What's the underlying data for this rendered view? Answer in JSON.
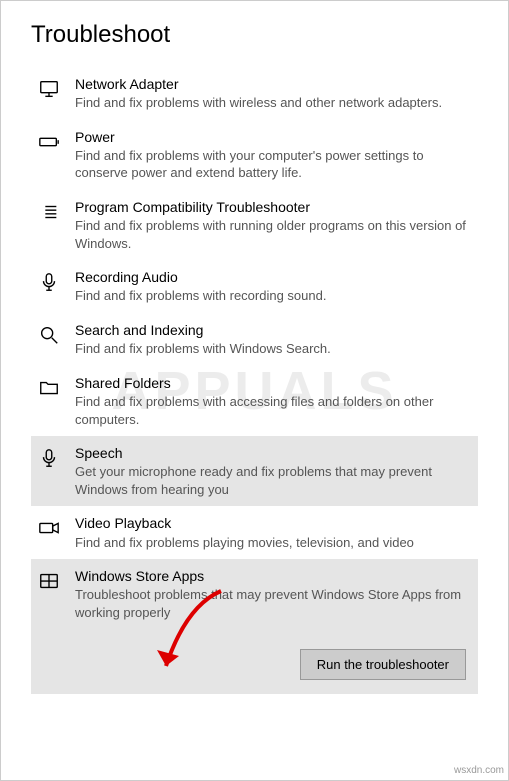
{
  "title": "Troubleshoot",
  "items": [
    {
      "title": "Network Adapter",
      "desc": "Find and fix problems with wireless and other network adapters.",
      "icon": "monitor",
      "selected": false
    },
    {
      "title": "Power",
      "desc": "Find and fix problems with your computer's power settings to conserve power and extend battery life.",
      "icon": "battery",
      "selected": false
    },
    {
      "title": "Program Compatibility Troubleshooter",
      "desc": "Find and fix problems with running older programs on this version of Windows.",
      "icon": "list",
      "selected": false
    },
    {
      "title": "Recording Audio",
      "desc": "Find and fix problems with recording sound.",
      "icon": "mic",
      "selected": false
    },
    {
      "title": "Search and Indexing",
      "desc": "Find and fix problems with Windows Search.",
      "icon": "search",
      "selected": false
    },
    {
      "title": "Shared Folders",
      "desc": "Find and fix problems with accessing files and folders on other computers.",
      "icon": "folder",
      "selected": false
    },
    {
      "title": "Speech",
      "desc": "Get your microphone ready and fix problems that may prevent Windows from hearing you",
      "icon": "mic",
      "selected": true
    },
    {
      "title": "Video Playback",
      "desc": "Find and fix problems playing movies, television, and video",
      "icon": "video",
      "selected": false
    },
    {
      "title": "Windows Store Apps",
      "desc": "Troubleshoot problems that may prevent Windows Store Apps from working properly",
      "icon": "store",
      "selected": false,
      "expanded": true
    }
  ],
  "run_button_label": "Run the troubleshooter",
  "watermark": "APPUALS",
  "attribution": "wsxdn.com"
}
